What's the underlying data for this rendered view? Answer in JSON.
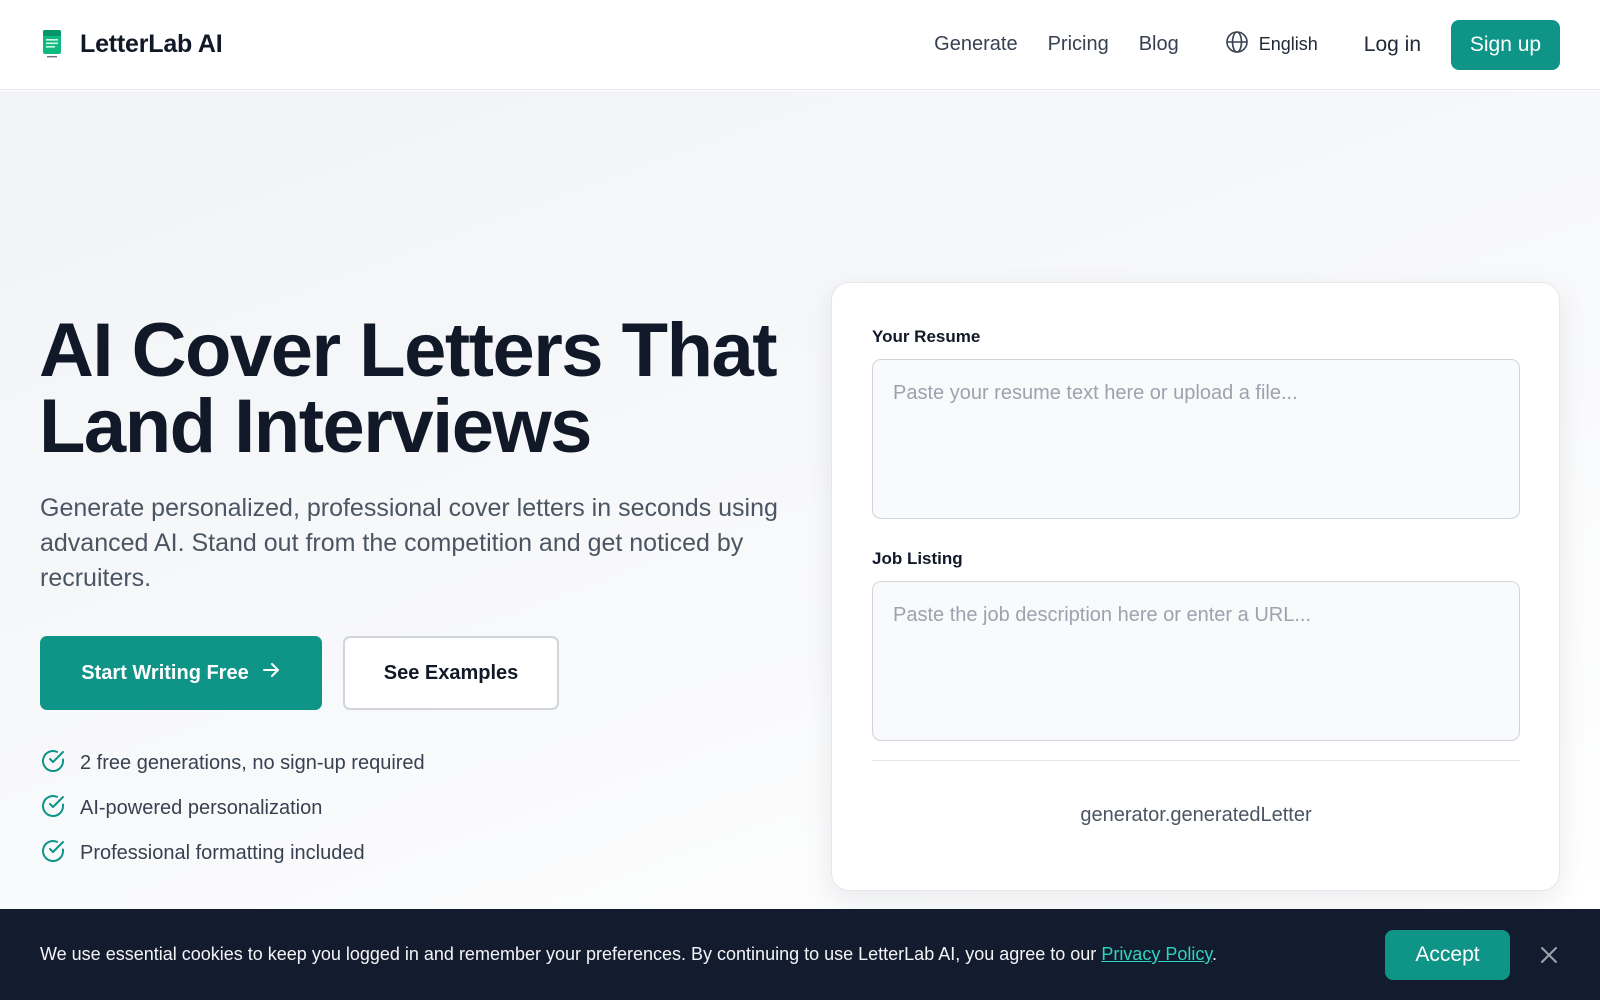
{
  "header": {
    "brand": "LetterLab AI",
    "nav": [
      "Generate",
      "Pricing",
      "Blog"
    ],
    "language": "English",
    "login": "Log in",
    "signup": "Sign up"
  },
  "hero": {
    "title_line1": "AI Cover Letters That",
    "title_line2": "Land Interviews",
    "subtitle": "Generate personalized, professional cover letters in seconds using advanced AI. Stand out from the competition and get noticed by recruiters.",
    "cta_primary": "Start Writing Free",
    "cta_secondary": "See Examples",
    "features": [
      "2 free generations, no sign-up required",
      "AI-powered personalization",
      "Professional formatting included"
    ]
  },
  "generator": {
    "resume_label": "Your Resume",
    "resume_placeholder": "Paste your resume text here or upload a file...",
    "job_label": "Job Listing",
    "job_placeholder": "Paste the job description here or enter a URL...",
    "generated_letter": "generator.generatedLetter"
  },
  "cookie": {
    "text_before": "We use essential cookies to keep you logged in and remember your preferences. By continuing to use LetterLab AI, you agree to our ",
    "link": "Privacy Policy",
    "text_after": ".",
    "accept": "Accept"
  },
  "colors": {
    "accent": "#0f9488",
    "dark": "#111827",
    "banner": "#131b2e"
  },
  "icons": [
    "document-logo-icon",
    "globe-icon",
    "arrow-right-icon",
    "check-circle-icon",
    "close-icon"
  ]
}
